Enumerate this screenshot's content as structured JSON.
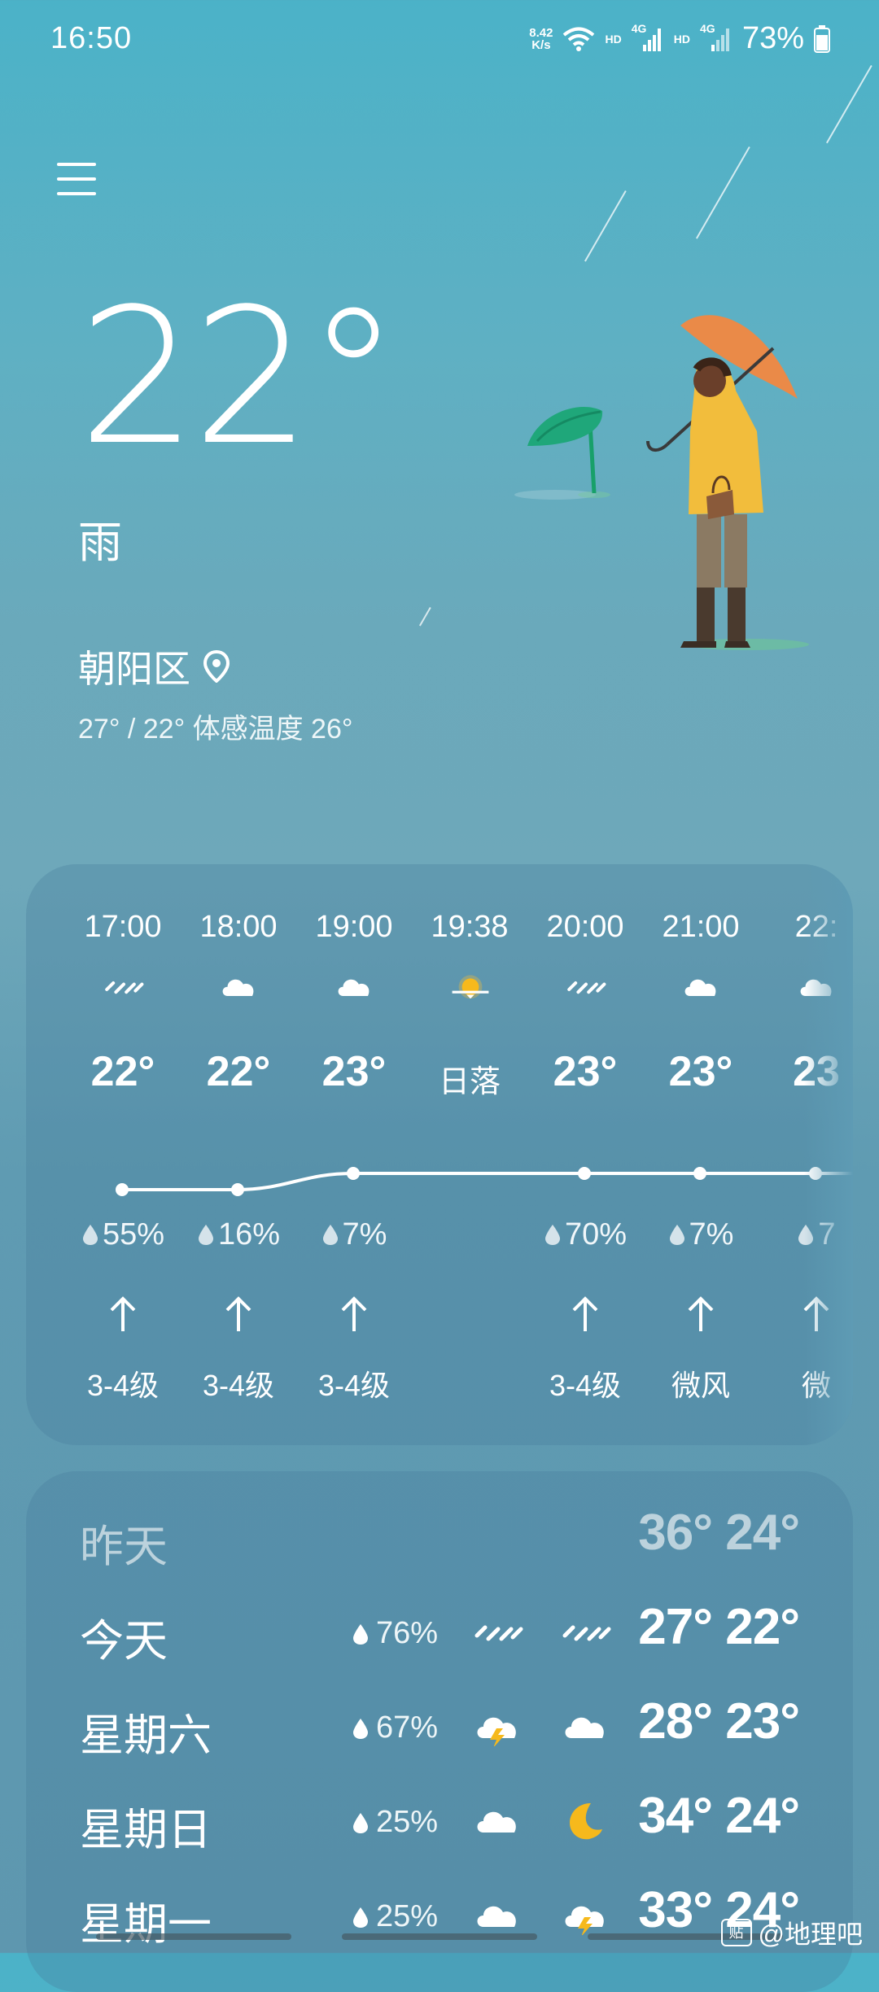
{
  "status_bar": {
    "time": "16:50",
    "net_speed_value": "8.42",
    "net_speed_unit": "K/s",
    "hd1": "HD",
    "sig1": "4G",
    "hd2": "HD",
    "sig2": "4G",
    "battery": "73%",
    "icons": [
      "wifi-icon",
      "signal-icon",
      "signal-icon",
      "battery-icon"
    ]
  },
  "header": {
    "temperature": "22°",
    "condition": "雨",
    "location": "朝阳区",
    "range": "27° / 22° 体感温度 26°"
  },
  "hourly": [
    {
      "time": "17:00",
      "icon": "rain-icon",
      "temp": "22°",
      "rain": "55%",
      "wind": "3-4级",
      "arrow": true
    },
    {
      "time": "18:00",
      "icon": "cloud-icon",
      "temp": "22°",
      "rain": "16%",
      "wind": "3-4级",
      "arrow": true
    },
    {
      "time": "19:00",
      "icon": "cloud-icon",
      "temp": "23°",
      "rain": "7%",
      "wind": "3-4级",
      "arrow": true
    },
    {
      "time": "19:38",
      "icon": "sunset-icon",
      "temp": "日落",
      "rain": "",
      "wind": "",
      "arrow": false
    },
    {
      "time": "20:00",
      "icon": "rain-icon",
      "temp": "23°",
      "rain": "70%",
      "wind": "3-4级",
      "arrow": true
    },
    {
      "time": "21:00",
      "icon": "cloud-icon",
      "temp": "23°",
      "rain": "7%",
      "wind": "微风",
      "arrow": true
    },
    {
      "time": "22:",
      "icon": "cloud-icon",
      "temp": "23",
      "rain": "7",
      "wind": "微",
      "arrow": true
    }
  ],
  "daily": [
    {
      "name": "昨天",
      "rain": "",
      "icon1": "",
      "icon2": "",
      "temps": "36° 24°",
      "dim": true
    },
    {
      "name": "今天",
      "rain": "76%",
      "icon1": "rain-icon",
      "icon2": "rain-icon",
      "temps": "27° 22°",
      "dim": false
    },
    {
      "name": "星期六",
      "rain": "67%",
      "icon1": "thunder-cloud-icon",
      "icon2": "cloud-icon",
      "temps": "28° 23°",
      "dim": false
    },
    {
      "name": "星期日",
      "rain": "25%",
      "icon1": "cloud-icon",
      "icon2": "moon-icon",
      "temps": "34° 24°",
      "dim": false
    },
    {
      "name": "星期一",
      "rain": "25%",
      "icon1": "cloud-icon",
      "icon2": "thunder-cloud-icon",
      "temps": "33° 24°",
      "dim": false
    }
  ],
  "watermark": {
    "badge": "贴",
    "text": "@地理吧"
  }
}
